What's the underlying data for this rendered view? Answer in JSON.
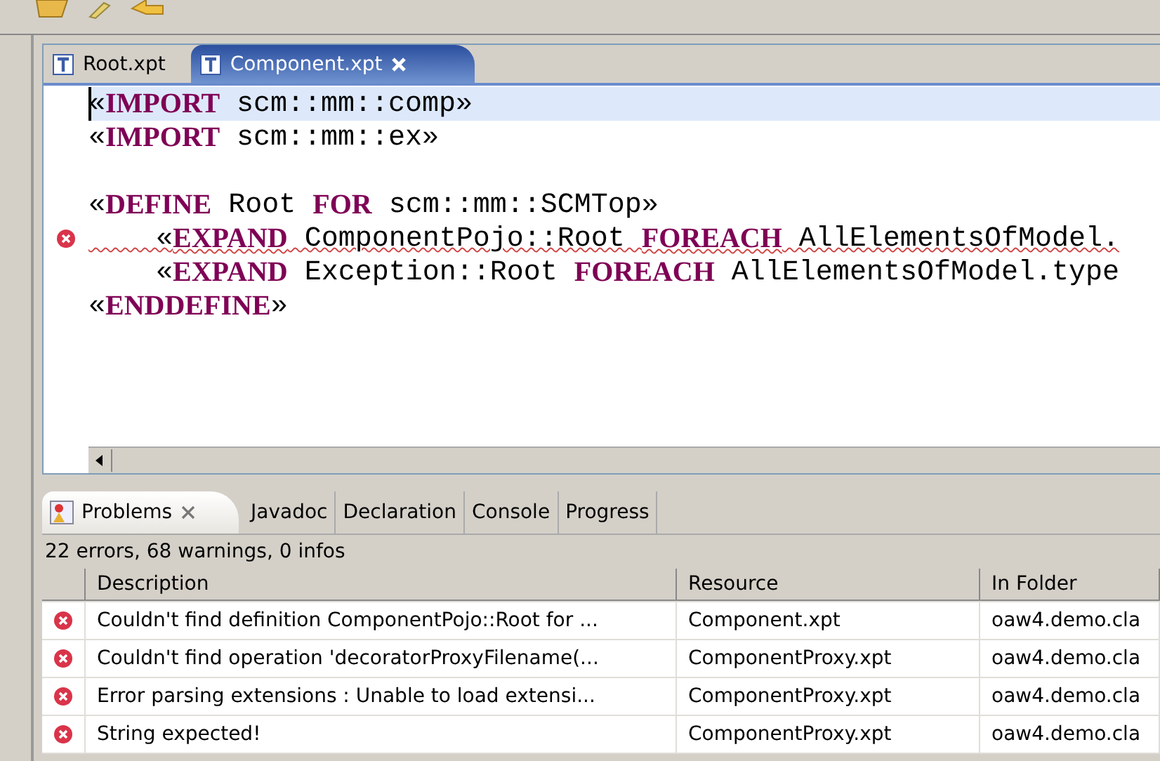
{
  "editor": {
    "tabs": [
      {
        "label": "Root.xpt",
        "selected": false
      },
      {
        "label": "Component.xpt",
        "selected": true
      }
    ],
    "lines": [
      {
        "kind": "code",
        "highlighted": true,
        "error": false,
        "segments": [
          {
            "kind": "plain",
            "text": "«"
          },
          {
            "kind": "keyword",
            "text": "IMPORT"
          },
          {
            "kind": "plain",
            "text": " scm::mm::comp»"
          }
        ]
      },
      {
        "kind": "code",
        "highlighted": false,
        "error": false,
        "segments": [
          {
            "kind": "plain",
            "text": "«"
          },
          {
            "kind": "keyword",
            "text": "IMPORT"
          },
          {
            "kind": "plain",
            "text": " scm::mm::ex»"
          }
        ]
      },
      {
        "kind": "blank"
      },
      {
        "kind": "code",
        "highlighted": false,
        "error": false,
        "segments": [
          {
            "kind": "plain",
            "text": "«"
          },
          {
            "kind": "keyword",
            "text": "DEFINE"
          },
          {
            "kind": "plain",
            "text": " Root "
          },
          {
            "kind": "keyword",
            "text": "FOR"
          },
          {
            "kind": "plain",
            "text": " scm::mm::SCMTop»"
          }
        ]
      },
      {
        "kind": "code",
        "highlighted": false,
        "error": true,
        "segments": [
          {
            "kind": "plain",
            "text": "    «"
          },
          {
            "kind": "keyword",
            "text": "EXPAND"
          },
          {
            "kind": "plain",
            "text": " ComponentPojo::Root "
          },
          {
            "kind": "keyword",
            "text": "FOREACH"
          },
          {
            "kind": "plain",
            "text": " AllElementsOfModel."
          }
        ]
      },
      {
        "kind": "code",
        "highlighted": false,
        "error": false,
        "segments": [
          {
            "kind": "plain",
            "text": "    «"
          },
          {
            "kind": "keyword",
            "text": "EXPAND"
          },
          {
            "kind": "plain",
            "text": " Exception::Root "
          },
          {
            "kind": "keyword",
            "text": "FOREACH"
          },
          {
            "kind": "plain",
            "text": " AllElementsOfModel.type"
          }
        ]
      },
      {
        "kind": "code",
        "highlighted": false,
        "error": false,
        "segments": [
          {
            "kind": "plain",
            "text": "«"
          },
          {
            "kind": "keyword",
            "text": "ENDDEFINE"
          },
          {
            "kind": "plain",
            "text": "»"
          }
        ]
      }
    ]
  },
  "panel": {
    "tabs": [
      {
        "label": "Problems",
        "selected": true
      },
      {
        "label": "Javadoc",
        "selected": false
      },
      {
        "label": "Declaration",
        "selected": false
      },
      {
        "label": "Console",
        "selected": false
      },
      {
        "label": "Progress",
        "selected": false
      }
    ],
    "summary": "22 errors, 68 warnings, 0 infos",
    "table": {
      "columns": [
        "Description",
        "Resource",
        "In Folder"
      ],
      "rows": [
        {
          "kind": "error",
          "description": "Couldn't find definition ComponentPojo::Root for ...",
          "resource": "Component.xpt",
          "folder": "oaw4.demo.cla"
        },
        {
          "kind": "error",
          "description": "Couldn't find operation 'decoratorProxyFilename(...",
          "resource": "ComponentProxy.xpt",
          "folder": "oaw4.demo.cla"
        },
        {
          "kind": "error",
          "description": "Error parsing extensions : Unable to load extensi...",
          "resource": "ComponentProxy.xpt",
          "folder": "oaw4.demo.cla"
        },
        {
          "kind": "error",
          "description": "String expected!",
          "resource": "ComponentProxy.xpt",
          "folder": "oaw4.demo.cla"
        }
      ]
    }
  }
}
